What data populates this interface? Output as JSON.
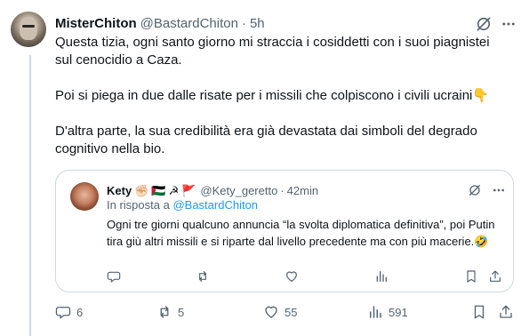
{
  "tweet": {
    "author_name": "MisterChiton",
    "author_handle": "@BastardChiton",
    "separator": "·",
    "time": "5h",
    "paragraphs": [
      "Questa tizia, ogni santo giorno mi straccia i cosiddetti con i suoi piagnistei sul cenocidio a Caza.",
      "Poi si piega in due dalle risate per i missili che colpiscono i civili ucraini👇",
      "D'altra parte, la sua credibilità era già devastata dai simboli del degrado cognitivo nella bio."
    ],
    "icons": {
      "grok": "grok-icon",
      "more": "more-icon"
    }
  },
  "quote": {
    "author_name": "Kety",
    "name_emojis": [
      "✊🏻",
      "🇵🇸",
      "☭",
      "🚩"
    ],
    "author_handle": "@Kety_geretto",
    "separator": "·",
    "time": "42min",
    "reply_prefix": "In risposta a",
    "reply_mention": "@BastardChiton",
    "text": "Ogni tre giorni qualcuno annuncia “la svolta diplomatica definitiva”, poi Putin tira giù altri missili e si riparte dal livello precedente ma con più macerie.🤣"
  },
  "actions": {
    "reply_count": "6",
    "repost_count": "5",
    "like_count": "55",
    "view_count": "591"
  },
  "colors": {
    "text": "#0f1419",
    "secondary": "#536471",
    "link": "#1d9bf0",
    "border": "#cfd9de"
  }
}
